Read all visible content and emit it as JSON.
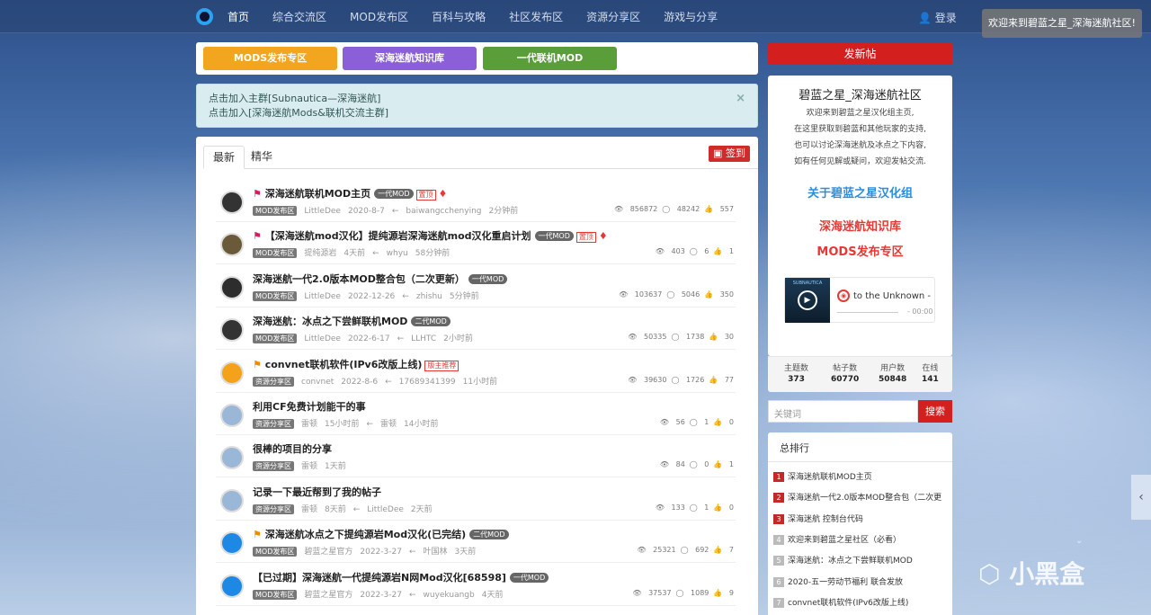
{
  "nav": {
    "items": [
      "首页",
      "综合交流区",
      "MOD发布区",
      "百科与攻略",
      "社区发布区",
      "资源分享区",
      "游戏与分享"
    ],
    "login": "登录"
  },
  "welcome_toast": "欢迎来到碧蓝之星_深海迷航社区!",
  "buttons": [
    {
      "label": "MODS发布专区",
      "color": "#f2a51f"
    },
    {
      "label": "深海迷航知识库",
      "color": "#8a5fd8"
    },
    {
      "label": "一代联机MOD",
      "color": "#5a9e3a"
    }
  ],
  "alert": {
    "line1": "点击加入主群[Subnautica—深海迷航]",
    "line2": "点击加入[深海迷航Mods&联机交流主群]",
    "close": "×"
  },
  "tabs": [
    "最新",
    "精华"
  ],
  "sign": "签到",
  "threads": [
    {
      "flag": "pink",
      "title": "深海迷航联机MOD主页",
      "tag": "一代MOD",
      "hot": "置顶",
      "gem": true,
      "section": "MOD发布区",
      "author": "LittleDee",
      "date": "2020-8-7",
      "replier": "baiwangcchenying",
      "time": "2分钟前",
      "views": "856872",
      "replies": "48242",
      "likes": "557"
    },
    {
      "flag": "pink",
      "title": "【深海迷航mod汉化】提纯源岩深海迷航mod汉化重启计划",
      "tag": "一代MOD",
      "hot": "置顶",
      "gem": true,
      "section": "MOD发布区",
      "author": "提纯源岩",
      "date": "4天前",
      "replier": "whyu",
      "time": "58分钟前",
      "views": "403",
      "replies": "6",
      "likes": "1"
    },
    {
      "flag": "",
      "title": "深海迷航一代2.0版本MOD整合包（二次更新）",
      "tag": "一代MOD",
      "hot": "",
      "gem": false,
      "section": "MOD发布区",
      "author": "LittleDee",
      "date": "2022-12-26",
      "replier": "zhishu",
      "time": "5分钟前",
      "views": "103637",
      "replies": "5046",
      "likes": "350"
    },
    {
      "flag": "",
      "title": "深海迷航：冰点之下尝鲜联机MOD",
      "tag": "二代MOD",
      "hot": "",
      "gem": false,
      "section": "MOD发布区",
      "author": "LittleDee",
      "date": "2022-6-17",
      "replier": "LLHTC",
      "time": "2小时前",
      "views": "50335",
      "replies": "1738",
      "likes": "30"
    },
    {
      "flag": "orange",
      "title": "convnet联机软件(IPv6改版上线)",
      "tag": "",
      "hot": "版主推荐",
      "gem": false,
      "section": "资源分享区",
      "author": "convnet",
      "date": "2022-8-6",
      "replier": "17689341399",
      "time": "11小时前",
      "views": "39630",
      "replies": "1726",
      "likes": "77"
    },
    {
      "flag": "",
      "title": "利用CF免费计划能干的事",
      "tag": "",
      "hot": "",
      "gem": false,
      "section": "资源分享区",
      "author": "雷顿",
      "date": "15小时前",
      "replier": "雷顿",
      "time": "14小时前",
      "views": "56",
      "replies": "1",
      "likes": "0"
    },
    {
      "flag": "",
      "title": "很棒的项目的分享",
      "tag": "",
      "hot": "",
      "gem": false,
      "section": "资源分享区",
      "author": "雷顿",
      "date": "1天前",
      "replier": "",
      "time": "",
      "views": "84",
      "replies": "0",
      "likes": "1"
    },
    {
      "flag": "",
      "title": "记录一下最近帮到了我的帖子",
      "tag": "",
      "hot": "",
      "gem": false,
      "section": "资源分享区",
      "author": "雷顿",
      "date": "8天前",
      "replier": "LittleDee",
      "time": "2天前",
      "views": "133",
      "replies": "1",
      "likes": "0"
    },
    {
      "flag": "orange",
      "title": "深海迷航冰点之下提纯源岩Mod汉化(已完结)",
      "tag": "二代MOD",
      "hot": "",
      "gem": false,
      "section": "MOD发布区",
      "author": "碧蓝之星官方",
      "date": "2022-3-27",
      "replier": "叶国林",
      "time": "3天前",
      "views": "25321",
      "replies": "692",
      "likes": "7"
    },
    {
      "flag": "",
      "title": "【已过期】深海迷航一代提纯源岩N网Mod汉化[68598]",
      "tag": "一代MOD",
      "hot": "",
      "gem": false,
      "section": "MOD发布区",
      "author": "碧蓝之星官方",
      "date": "2022-3-27",
      "replier": "wuyekuangb",
      "time": "4天前",
      "views": "37537",
      "replies": "1089",
      "likes": "9"
    }
  ],
  "side": {
    "post_button": "发新帖",
    "title": "碧蓝之星_深海迷航社区",
    "desc": [
      "欢迎来到碧蓝之星汉化组主页,",
      "在这里获取到碧蓝和其他玩家的支持,",
      "也可以讨论深海迷航及冰点之下内容,",
      "如有任何见解或疑问，欢迎发帖交流."
    ],
    "link_about": "关于碧蓝之星汉化组",
    "link_wiki": "深海迷航知识库",
    "link_mods": "MODS发布专区",
    "player": {
      "cover": "SUBNAUTICA",
      "title": "to the Unknown -",
      "time": "- 00:00"
    },
    "stats": [
      {
        "label": "主题数",
        "value": "373"
      },
      {
        "label": "帖子数",
        "value": "60770"
      },
      {
        "label": "用户数",
        "value": "50848"
      },
      {
        "label": "在线",
        "value": "141"
      }
    ],
    "search_placeholder": "关键词",
    "search_button": "搜索",
    "rank_title": "总排行",
    "rank": [
      {
        "n": "1",
        "text": "深海迷航联机MOD主页"
      },
      {
        "n": "2",
        "text": "深海迷航一代2.0版本MOD整合包（二次更"
      },
      {
        "n": "3",
        "text": "深海迷航 控制台代码"
      },
      {
        "n": "4",
        "text": "欢迎来到碧蓝之星社区（必看）"
      },
      {
        "n": "5",
        "text": "深海迷航：冰点之下尝鲜联机MOD"
      },
      {
        "n": "6",
        "text": "2020-五一劳动节福利 联合发放"
      },
      {
        "n": "7",
        "text": "convnet联机软件(IPv6改版上线)"
      }
    ]
  },
  "watermark": "小黑盒"
}
